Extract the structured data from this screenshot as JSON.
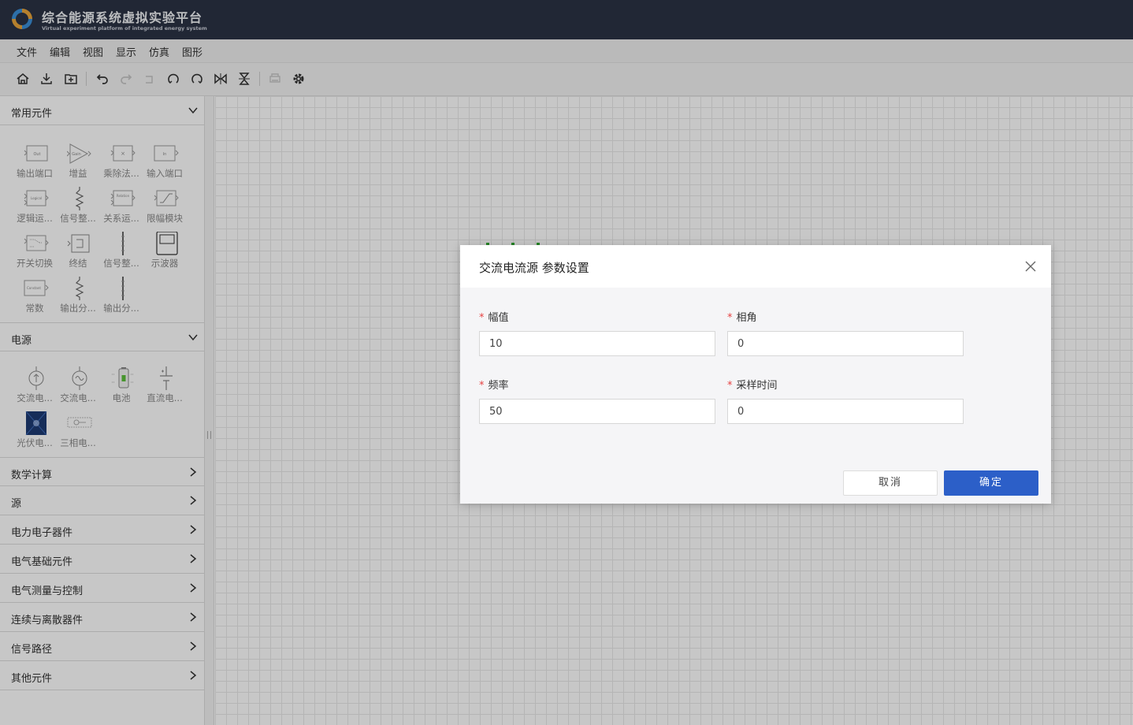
{
  "app": {
    "title": "综合能源系统虚拟实验平台",
    "subtitle": "Virtual experiment platform of integrated energy system"
  },
  "menu": [
    "文件",
    "编辑",
    "视图",
    "显示",
    "仿真",
    "图形"
  ],
  "toolbar_icons": [
    "home-icon",
    "download-icon",
    "new-folder-icon",
    "undo-icon",
    "redo-icon",
    "ungroup-icon",
    "rotate-left-icon",
    "rotate-right-icon",
    "flip-horizontal-icon",
    "flip-vertical-icon",
    "print-icon",
    "settings-icon"
  ],
  "sidebar": {
    "sections": [
      {
        "label": "常用元件",
        "expanded": true
      },
      {
        "label": "电源",
        "expanded": true
      },
      {
        "label": "数学计算",
        "expanded": false
      },
      {
        "label": "源",
        "expanded": false
      },
      {
        "label": "电力电子器件",
        "expanded": false
      },
      {
        "label": "电气基础元件",
        "expanded": false
      },
      {
        "label": "电气测量与控制",
        "expanded": false
      },
      {
        "label": "连续与离散器件",
        "expanded": false
      },
      {
        "label": "信号路径",
        "expanded": false
      },
      {
        "label": "其他元件",
        "expanded": false
      }
    ],
    "common": [
      {
        "label": "输出端口",
        "glyph": "Out"
      },
      {
        "label": "增益",
        "glyph": "Gain"
      },
      {
        "label": "乘除法...",
        "glyph": "×"
      },
      {
        "label": "输入端口",
        "glyph": "In"
      },
      {
        "label": "逻辑运...",
        "glyph": "Logical"
      },
      {
        "label": "信号整...",
        "glyph": ""
      },
      {
        "label": "关系运...",
        "glyph": "Relation"
      },
      {
        "label": "限幅模块",
        "glyph": ""
      },
      {
        "label": "开关切换",
        "glyph": ""
      },
      {
        "label": "终结",
        "glyph": ""
      },
      {
        "label": "信号整...",
        "glyph": ""
      },
      {
        "label": "示波器",
        "glyph": ""
      },
      {
        "label": "常数",
        "glyph": "Constant"
      },
      {
        "label": "输出分...",
        "glyph": ""
      },
      {
        "label": "输出分...",
        "glyph": ""
      }
    ],
    "power": [
      {
        "label": "交流电..."
      },
      {
        "label": "交流电..."
      },
      {
        "label": "电池"
      },
      {
        "label": "直流电..."
      },
      {
        "label": "光伏电..."
      },
      {
        "label": "三相电..."
      }
    ]
  },
  "dialog": {
    "title": "交流电流源 参数设置",
    "fields": [
      {
        "label": "幅值",
        "value": "10",
        "required": true
      },
      {
        "label": "相角",
        "value": "0",
        "required": true
      },
      {
        "label": "频率",
        "value": "50",
        "required": true
      },
      {
        "label": "采样时间",
        "value": "0",
        "required": true
      }
    ],
    "required_mark": "*",
    "cancel": "取消",
    "ok": "确定"
  },
  "colors": {
    "header_bg": "#2b3245",
    "primary": "#2c5fc8",
    "required": "#e64242"
  }
}
